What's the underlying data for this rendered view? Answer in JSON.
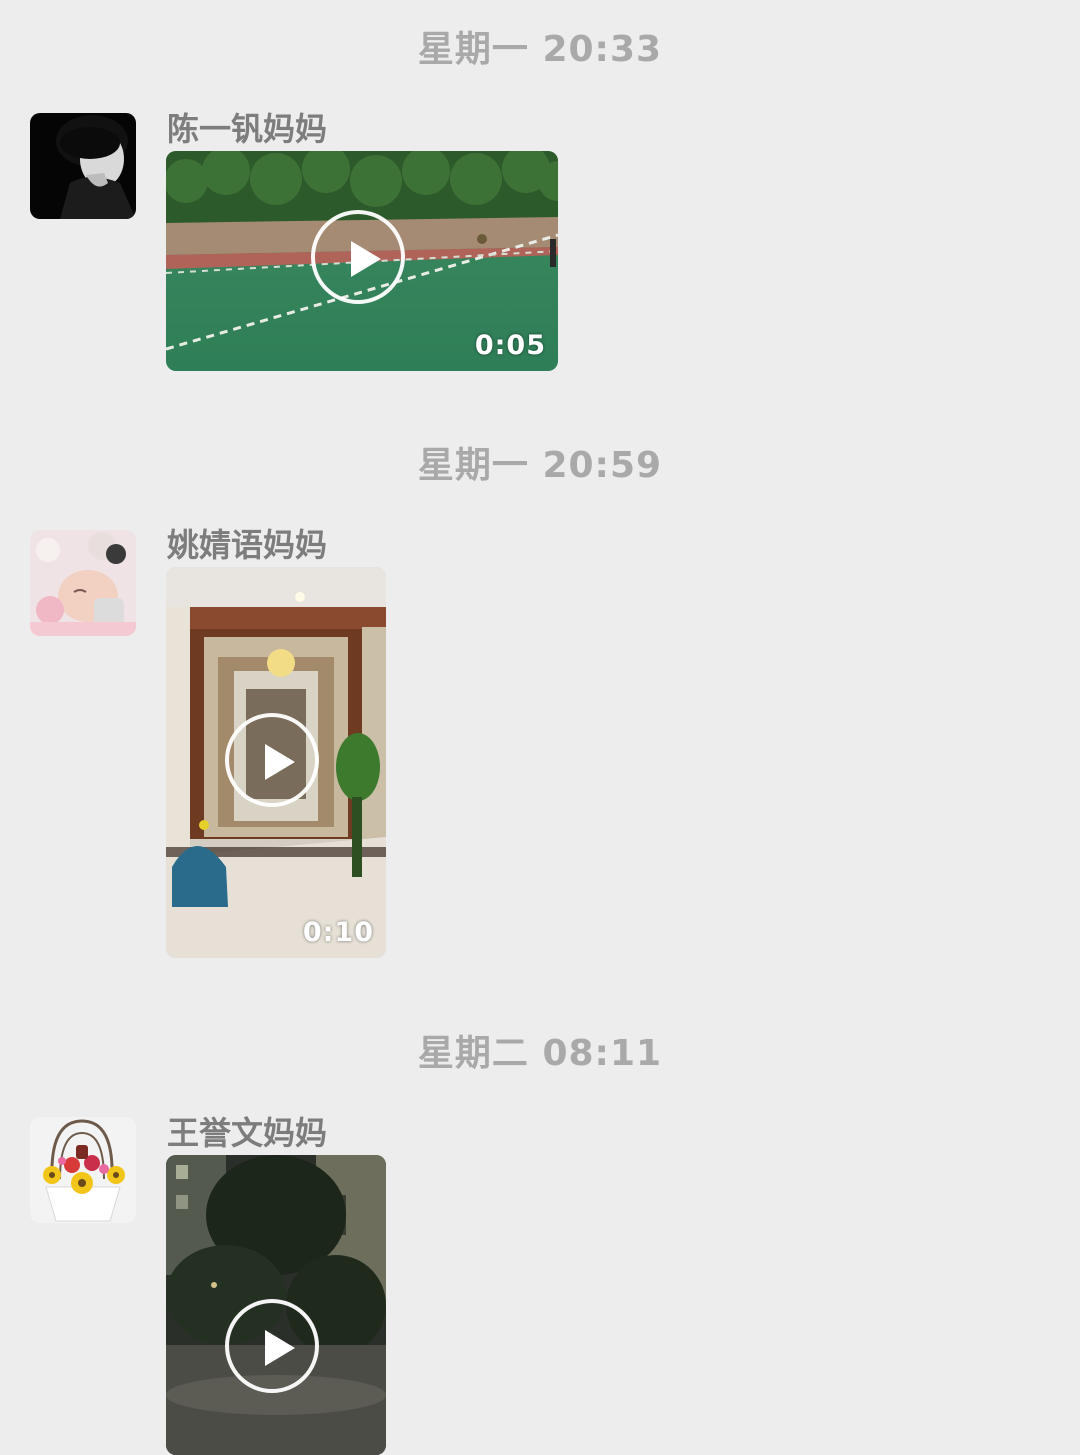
{
  "messages": [
    {
      "timestamp": "星期一 20:33",
      "sender": "陈一钒妈妈",
      "avatar": "woman-portrait",
      "video": {
        "duration": "0:05",
        "scene": "outdoor-court"
      }
    },
    {
      "timestamp": "星期一 20:59",
      "sender": "姚婧语妈妈",
      "avatar": "sleeping-baby",
      "video": {
        "duration": "0:10",
        "scene": "home-hallway"
      }
    },
    {
      "timestamp": "星期二 08:11",
      "sender": "王誉文妈妈",
      "avatar": "flower-basket",
      "video": {
        "duration": "",
        "scene": "night-garden"
      }
    }
  ],
  "colors": {
    "background": "#ededed",
    "timestamp": "#a9a9a9",
    "sender": "#7d7d7d"
  }
}
